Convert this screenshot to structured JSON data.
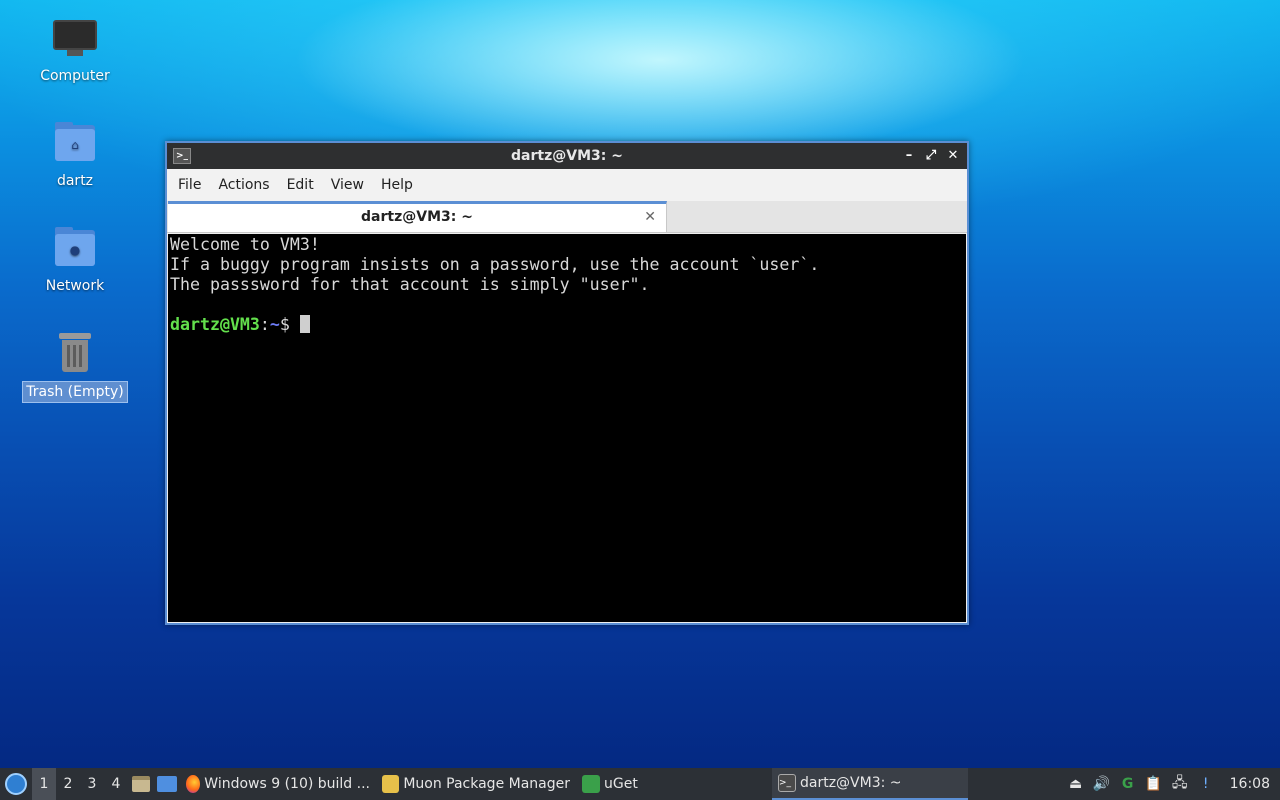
{
  "desktop": {
    "icons": [
      {
        "label": "Computer"
      },
      {
        "label": "dartz"
      },
      {
        "label": "Network"
      },
      {
        "label": "Trash (Empty)"
      }
    ]
  },
  "window": {
    "title": "dartz@VM3: ~",
    "controls": {
      "minimize": "–",
      "maximize": "⤢",
      "close": "✕"
    },
    "menu": [
      "File",
      "Actions",
      "Edit",
      "View",
      "Help"
    ],
    "tab": {
      "label": "dartz@VM3: ~",
      "close": "✕"
    },
    "terminal": {
      "lines": [
        "Welcome to VM3!",
        "If a buggy program insists on a password, use the account `user`.",
        "The passsword for that account is simply \"user\"."
      ],
      "prompt_user": "dartz@VM3",
      "prompt_sep": ":",
      "prompt_path": "~",
      "prompt_symbol": "$ "
    }
  },
  "taskbar": {
    "workspaces": [
      "1",
      "2",
      "3",
      "4"
    ],
    "active_workspace": "1",
    "tasks": [
      {
        "label": "Windows 9 (10) build ...",
        "icon": "firefox-icon"
      },
      {
        "label": "Muon Package Manager",
        "icon": "muon-icon"
      },
      {
        "label": "uGet",
        "icon": "uget-icon"
      }
    ],
    "current_task": {
      "label": "dartz@VM3: ~",
      "icon": "terminal-icon"
    },
    "clock": "16:08"
  },
  "colors": {
    "accent": "#5b8fd4",
    "prompt_user": "#63e04c",
    "prompt_path": "#6d7cf5",
    "terminal_bg": "#000000",
    "taskbar_bg": "#2c3036"
  }
}
